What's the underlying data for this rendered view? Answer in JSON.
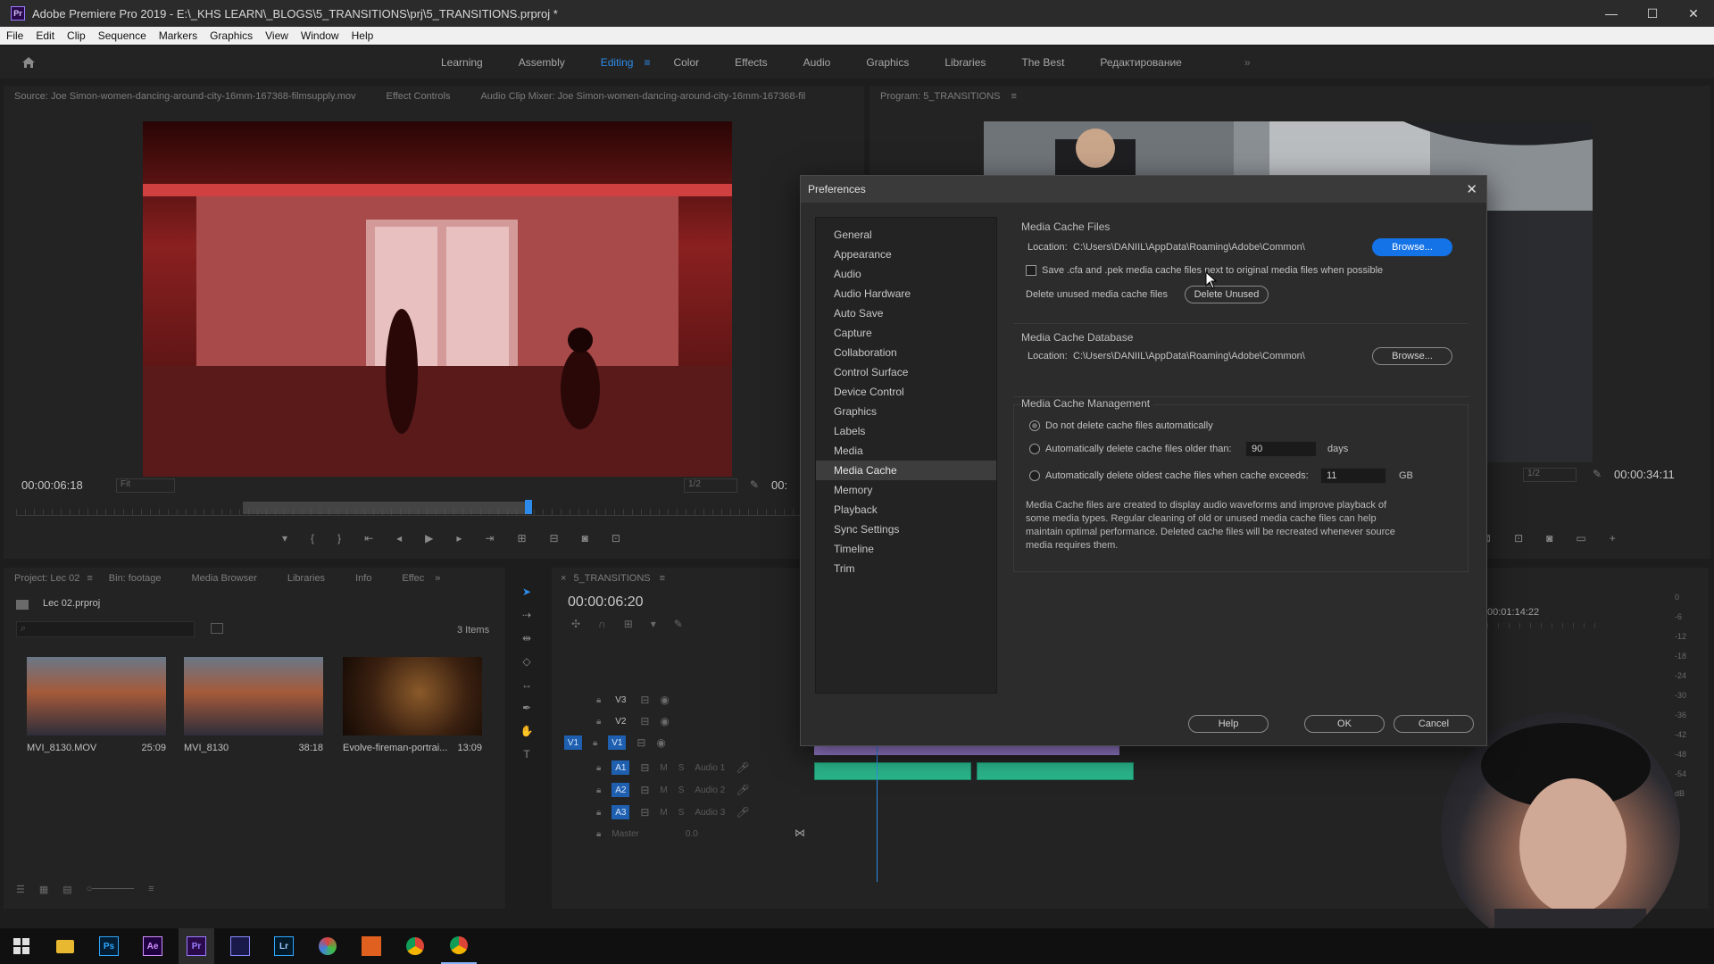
{
  "titlebar": {
    "title": "Adobe Premiere Pro 2019 - E:\\_KHS LEARN\\_BLOGS\\5_TRANSITIONS\\prj\\5_TRANSITIONS.prproj *",
    "app_icon_text": "Pr",
    "minimize": "—",
    "maximize": "☐",
    "close": "✕"
  },
  "menu": [
    "File",
    "Edit",
    "Clip",
    "Sequence",
    "Markers",
    "Graphics",
    "View",
    "Window",
    "Help"
  ],
  "workspaces": [
    "Learning",
    "Assembly",
    "Editing",
    "Color",
    "Effects",
    "Audio",
    "Graphics",
    "Libraries",
    "The Best",
    "Редактирование"
  ],
  "active_workspace": "Editing",
  "source_panel": {
    "tabs": [
      "Source: Joe Simon-women-dancing-around-city-16mm-167368-filmsupply.mov",
      "Effect Controls",
      "Audio Clip Mixer: Joe Simon-women-dancing-around-city-16mm-167368-fil"
    ],
    "timecode": "00:00:06:18",
    "fit": "Fit",
    "resolution": "1/2",
    "duration": "00:"
  },
  "program_panel": {
    "tab": "Program: 5_TRANSITIONS",
    "resolution": "1/2",
    "timecode": "00:00:34:11"
  },
  "project_panel": {
    "tabs": [
      "Project: Lec 02",
      "Bin: footage",
      "Media Browser",
      "Libraries",
      "Info",
      "Effec"
    ],
    "project_name": "Lec 02.prproj",
    "items_count": "3 Items",
    "items": [
      {
        "name": "MVI_8130.MOV",
        "duration": "25:09"
      },
      {
        "name": "MVI_8130",
        "duration": "38:18"
      },
      {
        "name": "Evolve-fireman-portrai...",
        "duration": "13:09"
      }
    ]
  },
  "timeline": {
    "tab": "5_TRANSITIONS",
    "timecode": "00:00:06:20",
    "ruler_time": "00:01:14:22",
    "video_tracks": [
      "V3",
      "V2",
      "V1"
    ],
    "audio_tracks": [
      {
        "id": "A1",
        "name": "Audio 1"
      },
      {
        "id": "A2",
        "name": "Audio 2"
      },
      {
        "id": "A3",
        "name": "Audio 3"
      }
    ],
    "master_label": "Master",
    "master_value": "0.0",
    "source_patch": "V1",
    "meter_labels": [
      "0",
      "-6",
      "-12",
      "-18",
      "-24",
      "-30",
      "-36",
      "-42",
      "-48",
      "-54",
      "dB"
    ]
  },
  "preferences": {
    "title": "Preferences",
    "categories": [
      "General",
      "Appearance",
      "Audio",
      "Audio Hardware",
      "Auto Save",
      "Capture",
      "Collaboration",
      "Control Surface",
      "Device Control",
      "Graphics",
      "Labels",
      "Media",
      "Media Cache",
      "Memory",
      "Playback",
      "Sync Settings",
      "Timeline",
      "Trim"
    ],
    "selected_category": "Media Cache",
    "media_cache_files": {
      "title": "Media Cache Files",
      "location_label": "Location:",
      "location": "C:\\Users\\DANIIL\\AppData\\Roaming\\Adobe\\Common\\",
      "browse": "Browse...",
      "save_next_to_original": "Save .cfa and .pek media cache files next to original media files when possible",
      "save_next_to_original_checked": false,
      "delete_unused_label": "Delete unused media cache files",
      "delete_unused_button": "Delete Unused"
    },
    "media_cache_database": {
      "title": "Media Cache Database",
      "location_label": "Location:",
      "location": "C:\\Users\\DANIIL\\AppData\\Roaming\\Adobe\\Common\\",
      "browse": "Browse..."
    },
    "media_cache_management": {
      "title": "Media Cache Management",
      "option_no_delete": "Do not delete cache files automatically",
      "option_older_than": "Automatically delete cache files older than:",
      "older_than_value": "90",
      "older_than_unit": "days",
      "option_exceeds": "Automatically delete oldest cache files when cache exceeds:",
      "exceeds_value": "11",
      "exceeds_unit": "GB",
      "selected": "option_no_delete",
      "description": "Media Cache files are created to display audio waveforms and improve playback of some media types. Regular cleaning of old or unused media cache files can help maintain optimal performance. Deleted cache files will be recreated whenever source media requires them."
    },
    "buttons": {
      "help": "Help",
      "ok": "OK",
      "cancel": "Cancel"
    }
  },
  "taskbar": {
    "apps": [
      "windows-start",
      "file-explorer",
      "Ps",
      "Ae",
      "Pr",
      "Media Encoder",
      "Lr",
      "DaVinci Resolve",
      "Studio",
      "Chrome",
      "Chrome"
    ]
  },
  "colors": {
    "accent": "#1473e6",
    "workspace_active": "#2d8ceb",
    "clip_video": "#9b7fd4",
    "clip_audio": "#2bb58a",
    "track_badge": "#1e5fb0"
  }
}
